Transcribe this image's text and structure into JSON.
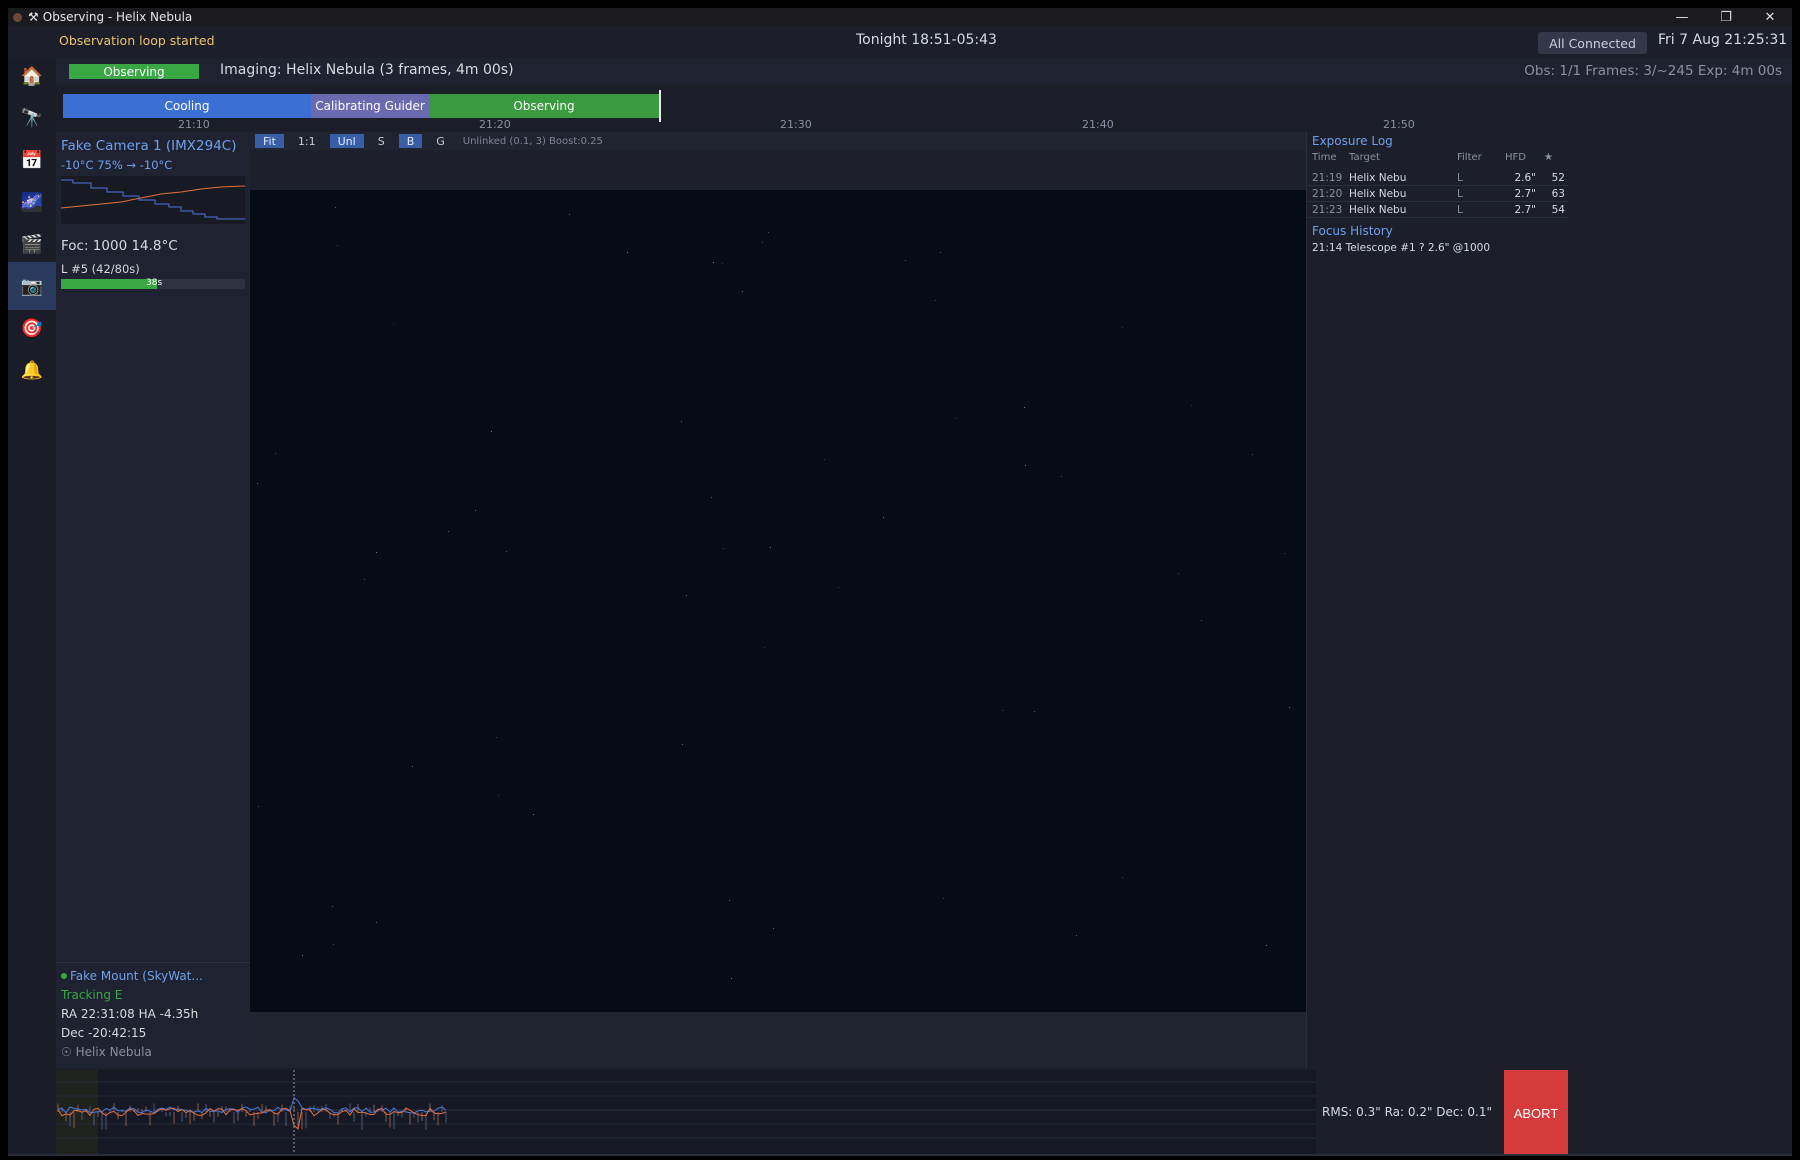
{
  "window": {
    "title": "Observing - Helix Nebula",
    "minimize_glyph": "—",
    "restore_glyph": "❐",
    "close_glyph": "✕"
  },
  "status": {
    "message": "Observation  loop  started",
    "tonight": "Tonight  18:51-05:43",
    "connection": "All  Connected",
    "datetime": "Fri  7  Aug  21:25:31"
  },
  "nav": {
    "items": [
      {
        "name": "home-icon",
        "glyph": "🏠"
      },
      {
        "name": "telescope-icon",
        "glyph": "🔭"
      },
      {
        "name": "calendar-icon",
        "glyph": "📅"
      },
      {
        "name": "galaxy-icon",
        "glyph": "🌌"
      },
      {
        "name": "sequence-icon",
        "glyph": "🎬"
      },
      {
        "name": "camera-icon",
        "glyph": "📷"
      },
      {
        "name": "target-icon",
        "glyph": "🎯"
      },
      {
        "name": "bell-icon",
        "glyph": "🔔"
      }
    ],
    "active_index": 5
  },
  "imaging": {
    "state_badge": "Observing",
    "description": "Imaging:  Helix  Nebula  (3  frames,  4m  00s)",
    "stats": "Obs:  1/1     Frames:  3/~245     Exp:  4m  00s"
  },
  "timeline": {
    "phases": [
      {
        "label": "Cooling",
        "color": "#3b6fd4"
      },
      {
        "label": "Calibrating  Guider",
        "color": "#6a6ab0"
      },
      {
        "label": "Observing",
        "color": "#3a9a3f"
      }
    ],
    "ticks": [
      "21:10",
      "21:20",
      "21:30",
      "21:40",
      "21:50"
    ]
  },
  "camera": {
    "name": "Fake  Camera  1  (IMX294C)",
    "temp_line": "-10°C    75%    →  -10°C",
    "focuser": "Foc:  1000      14.8°C",
    "exposure": "L  #5  (42/80s)",
    "exposure_progress": 0.52,
    "remaining": "38s"
  },
  "mount": {
    "name": "Fake  Mount  (SkyWat...",
    "tracking": "Tracking     E",
    "ra": "RA  22:31:08    HA  -4.35h",
    "dec": "Dec  -20:42:15",
    "target": "☉  Helix  Nebula"
  },
  "viewer": {
    "buttons": [
      {
        "label": "Fit",
        "on": true
      },
      {
        "label": "1:1",
        "on": false
      },
      {
        "label": "Unl",
        "on": true
      },
      {
        "label": "S",
        "on": false
      },
      {
        "label": "B",
        "on": true
      },
      {
        "label": "G",
        "on": false
      }
    ],
    "stretch_info": "Unlinked  (0.1,  3)  Boost:0.25"
  },
  "exposure_log": {
    "title": "Exposure  Log",
    "headers": {
      "time": "Time",
      "target": "Target",
      "filter": "Filter",
      "hfd": "HFD",
      "stars": "★"
    },
    "rows": [
      {
        "time": "21:19",
        "target": "Helix  Nebu",
        "filter": "L",
        "hfd": "2.6\"",
        "stars": "52"
      },
      {
        "time": "21:20",
        "target": "Helix  Nebu",
        "filter": "L",
        "hfd": "2.7\"",
        "stars": "63"
      },
      {
        "time": "21:23",
        "target": "Helix  Nebu",
        "filter": "L",
        "hfd": "2.7\"",
        "stars": "54"
      }
    ]
  },
  "focus_history": {
    "title": "Focus  History",
    "entries": [
      "21:14  Telescope  #1  ?  2.6\"  @1000"
    ]
  },
  "guiding": {
    "stats": "RMS:  0.3\"   Ra:  0.2\"   Dec:  0.1\"",
    "abort_label": "ABORT"
  },
  "colors": {
    "accent": "#6fa0ea",
    "success": "#3aa745",
    "warning": "#e9c46a",
    "danger": "#d63b3b",
    "ra_line": "#4a78d8",
    "dec_line": "#e07040"
  }
}
